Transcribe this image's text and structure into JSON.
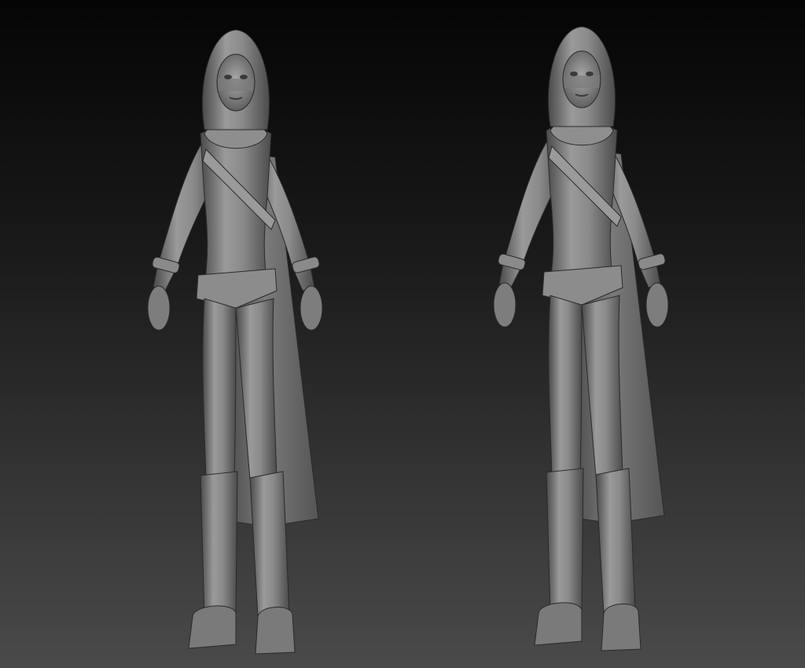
{
  "viewport": {
    "background_top": "#050505",
    "background_bottom": "#4a4a4a"
  },
  "models": [
    {
      "name": "sculpt-left",
      "material": "matcap-gray"
    },
    {
      "name": "sculpt-right",
      "material": "matcap-gray"
    }
  ],
  "colors": {
    "clay_light": "#9c9c9c",
    "clay_mid": "#6f6f6f",
    "clay_dark": "#3c3c3c",
    "edge": "#2a2a2a"
  }
}
